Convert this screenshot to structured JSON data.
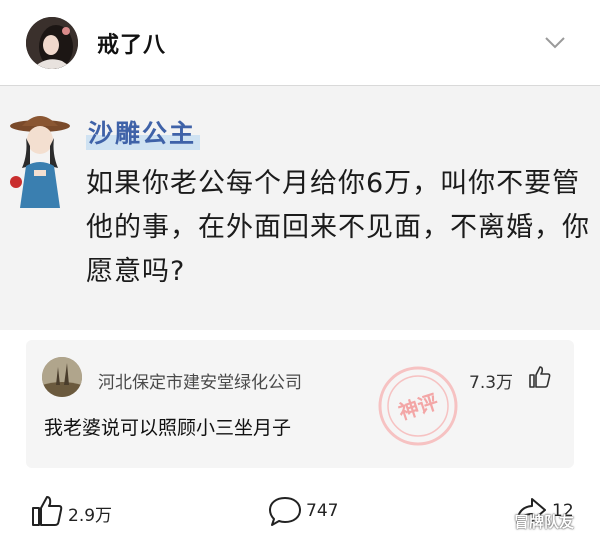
{
  "header": {
    "title": "戒了八",
    "accent": "#111111"
  },
  "post": {
    "author": "沙雕公主",
    "author_color": "#3f62a8",
    "text": "如果你老公每个月给你6万，叫你不要管他的事，在外面回来不见面，不离婚，你愿意吗?"
  },
  "comment": {
    "user": "河北保定市建安堂绿化公司",
    "likes": "7.3万",
    "text": "我老婆说可以照顾小三坐月子",
    "badge": "神评"
  },
  "actions": {
    "like_count": "2.9万",
    "comment_count": "747",
    "share_count": "12"
  },
  "watermark": "冒牌队友",
  "icons": {
    "more": "chevron-down-icon",
    "like": "thumbs-up-icon",
    "comment": "speech-bubble-icon",
    "share": "share-arrow-icon"
  }
}
